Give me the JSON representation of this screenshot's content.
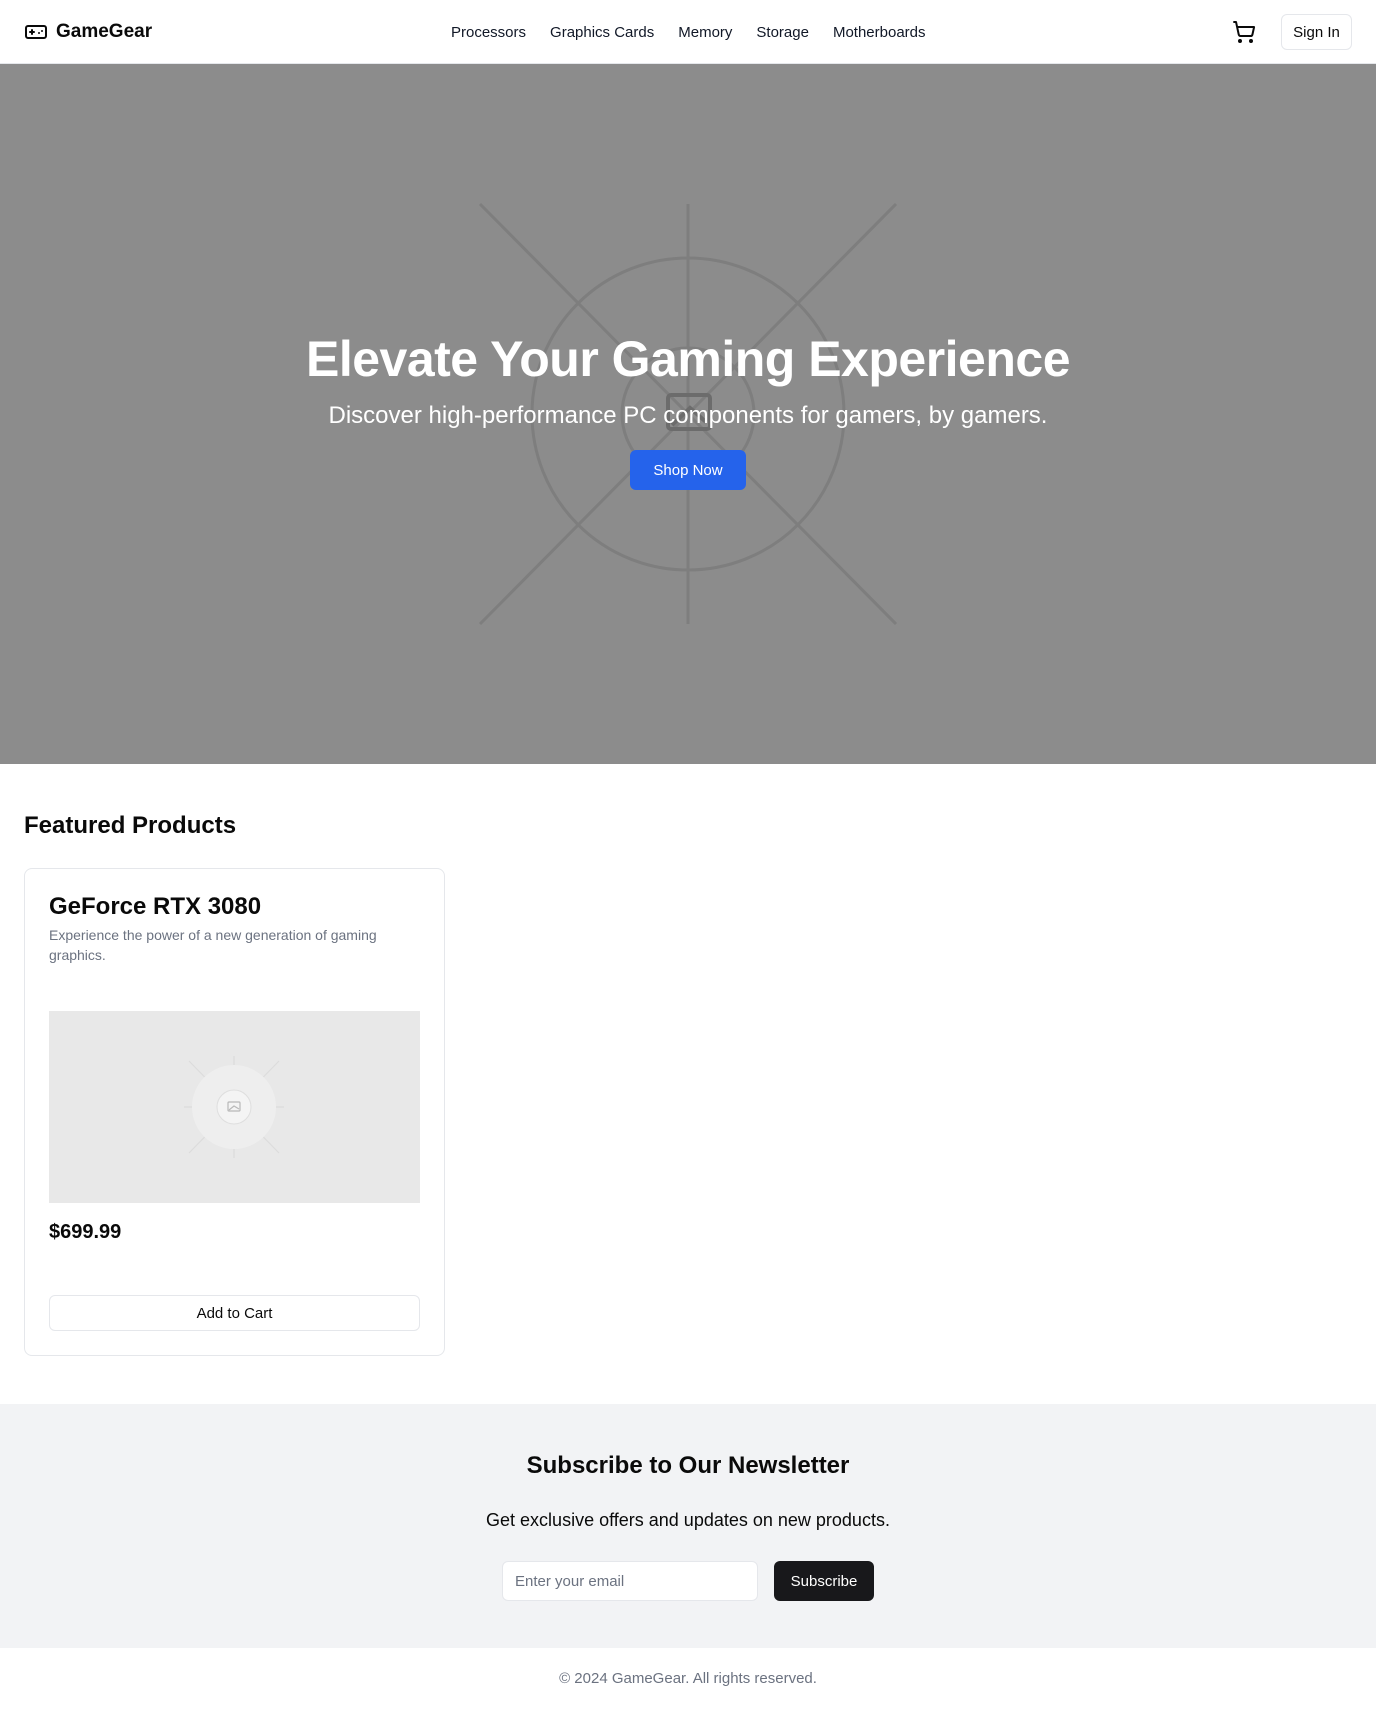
{
  "header": {
    "brand": "GameGear",
    "brand_icon": "gamepad-icon",
    "nav": [
      "Processors",
      "Graphics Cards",
      "Memory",
      "Storage",
      "Motherboards"
    ],
    "cart_icon": "cart-icon",
    "signin_label": "Sign In"
  },
  "hero": {
    "title": "Elevate Your Gaming Experience",
    "subtitle": "Discover high-performance PC components for gamers, by gamers.",
    "cta_label": "Shop Now",
    "background_color": "#8c8c8c",
    "cta_color": "#2563eb"
  },
  "featured": {
    "title": "Featured Products",
    "products": [
      {
        "name": "GeForce RTX 3080",
        "description": "Experience the power of a new generation of gaming graphics.",
        "price": "$699.99",
        "button_label": "Add to Cart",
        "image_icon": "image-placeholder-icon"
      }
    ]
  },
  "newsletter": {
    "title": "Subscribe to Our Newsletter",
    "subtitle": "Get exclusive offers and updates on new products.",
    "email_placeholder": "Enter your email",
    "button_label": "Subscribe"
  },
  "footer": {
    "copyright": "© 2024 GameGear. All rights reserved."
  }
}
